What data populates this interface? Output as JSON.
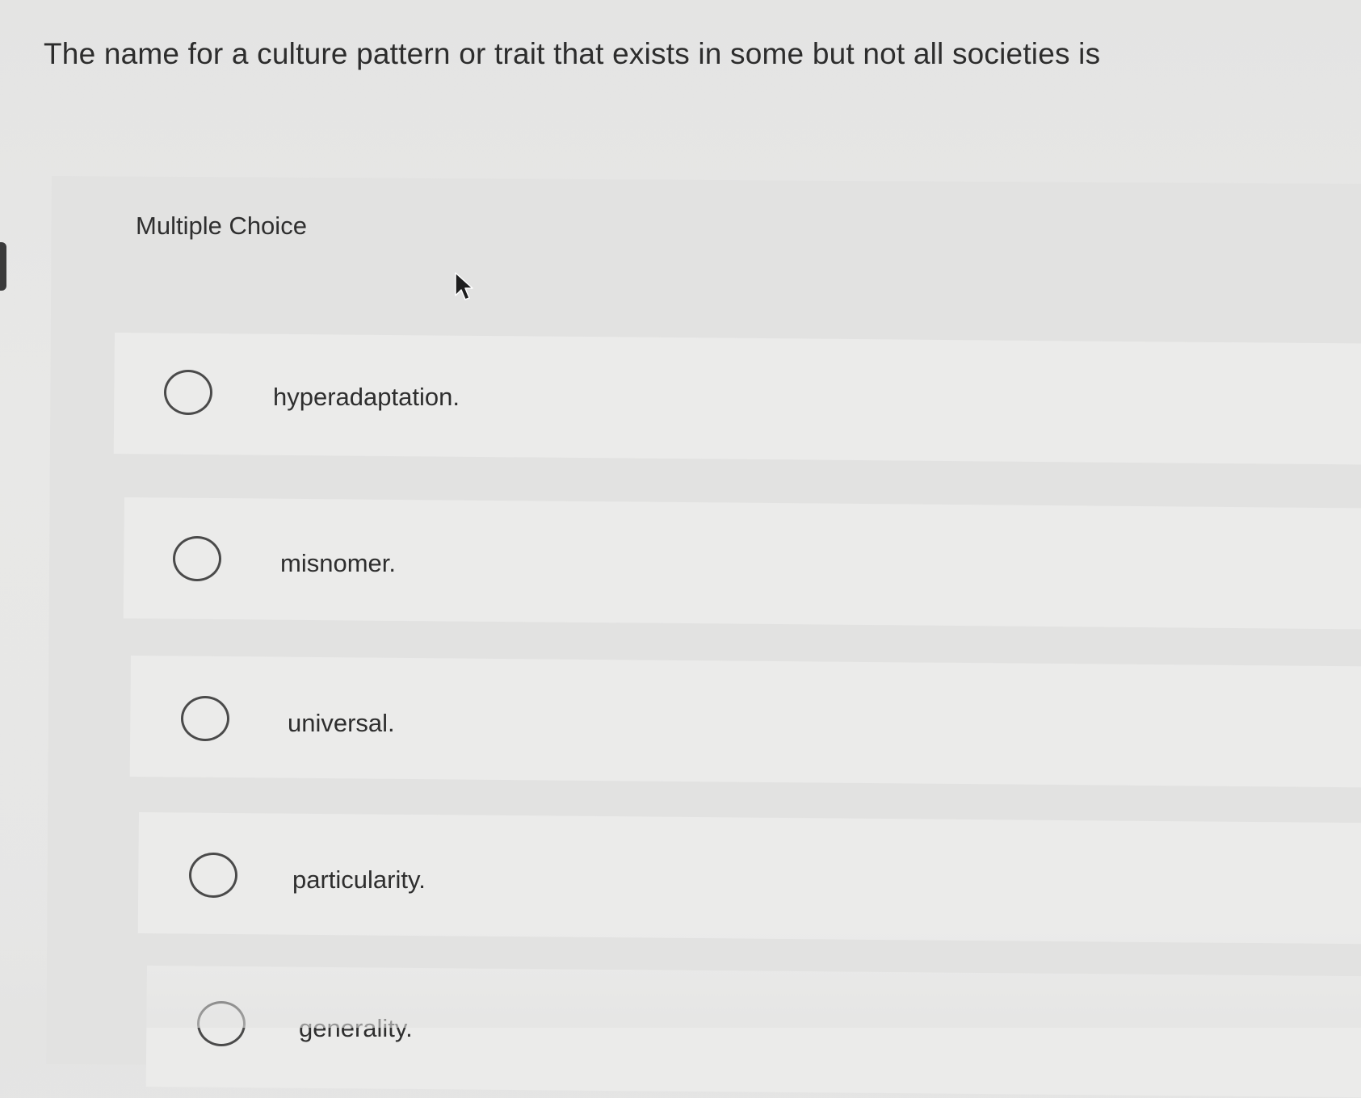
{
  "question": {
    "text": "The name for a culture pattern or trait that exists in some but not all societies is"
  },
  "panel": {
    "title": "Multiple Choice"
  },
  "options": [
    {
      "label": "hyperadaptation."
    },
    {
      "label": "misnomer."
    },
    {
      "label": "universal."
    },
    {
      "label": "particularity."
    },
    {
      "label": "generality."
    }
  ],
  "icons": {
    "cursor": "mouse-pointer-icon",
    "radio": "radio-button-icon"
  },
  "colors": {
    "background": "#e6e6e5",
    "option_background": "#ebebea",
    "text": "#2d2d2d",
    "radio_border": "#4a4a4a"
  }
}
